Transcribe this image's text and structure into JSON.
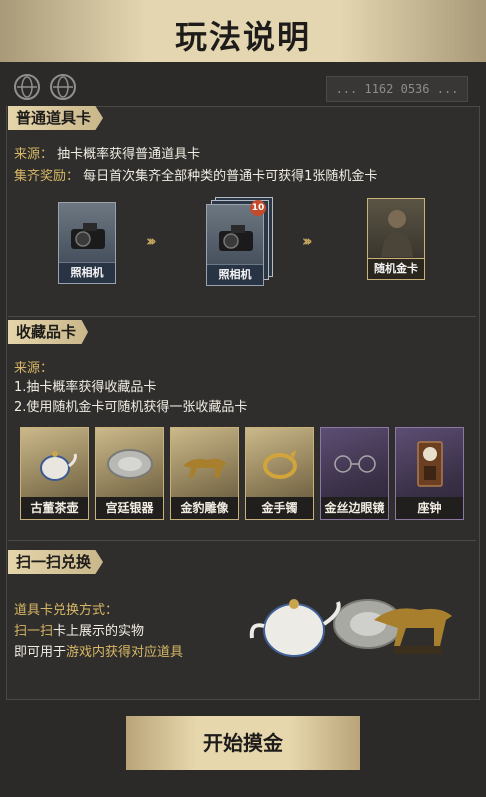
{
  "header": {
    "title": "玩法说明"
  },
  "serial": "... 1162 0536 ...",
  "section1": {
    "tab": "普通道具卡",
    "source_label": "来源：",
    "source_text": "抽卡概率获得普通道具卡",
    "reward_label": "集齐奖励：",
    "reward_text": "每日首次集齐全部种类的普通卡可获得1张随机金卡",
    "card1_label": "照相机",
    "card2_label": "照相机",
    "card2_badge": "10",
    "card3_label": "随机金卡",
    "arrow": "›››"
  },
  "section2": {
    "tab": "收藏品卡",
    "source_label": "来源：",
    "line1": "1.抽卡概率获得收藏品卡",
    "line2": "2.使用随机金卡可随机获得一张收藏品卡",
    "cards": [
      "古董茶壶",
      "宫廷银器",
      "金豹雕像",
      "金手镯",
      "金丝边眼镜",
      "座钟"
    ]
  },
  "section3": {
    "tab": "扫一扫兑换",
    "method_label": "道具卡兑换方式：",
    "line1_gold": "扫一扫",
    "line1_rest": "卡上展示的实物",
    "line2_prefix": "即可用于",
    "line2_gold": "游戏内获得对应道具"
  },
  "start_button": "开始摸金"
}
